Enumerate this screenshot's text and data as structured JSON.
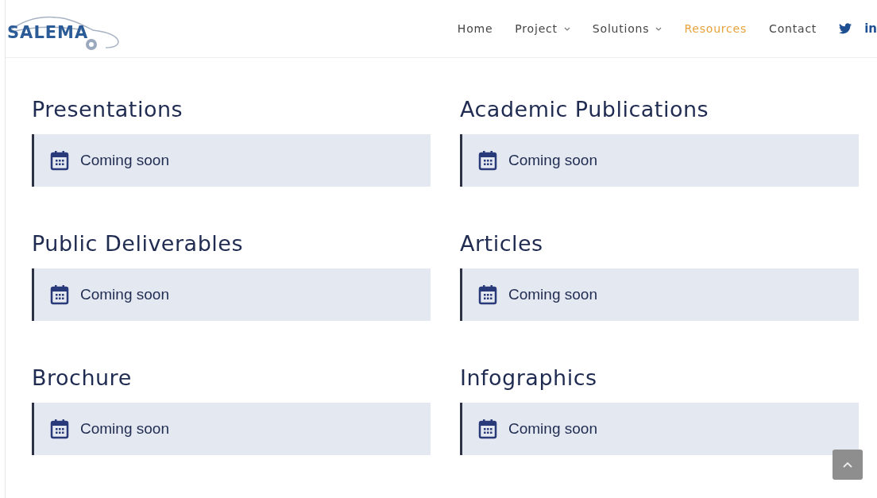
{
  "header": {
    "logo": "SALEMA",
    "nav": [
      {
        "label": "Home",
        "dropdown": false,
        "selected": false
      },
      {
        "label": "Project",
        "dropdown": true,
        "selected": false
      },
      {
        "label": "Solutions",
        "dropdown": true,
        "selected": false
      },
      {
        "label": "Resources",
        "dropdown": false,
        "selected": true
      },
      {
        "label": "Contact",
        "dropdown": false,
        "selected": false
      }
    ],
    "social": [
      {
        "kind": "twitter"
      },
      {
        "kind": "linkedin",
        "label": "in"
      }
    ]
  },
  "sections": [
    {
      "title": "Presentations",
      "notice": "Coming soon"
    },
    {
      "title": "Academic Publications",
      "notice": "Coming soon"
    },
    {
      "title": "Public Deliverables",
      "notice": "Coming soon"
    },
    {
      "title": "Articles",
      "notice": "Coming soon"
    },
    {
      "title": "Brochure",
      "notice": "Coming soon"
    },
    {
      "title": "Infographics",
      "notice": "Coming soon"
    }
  ]
}
